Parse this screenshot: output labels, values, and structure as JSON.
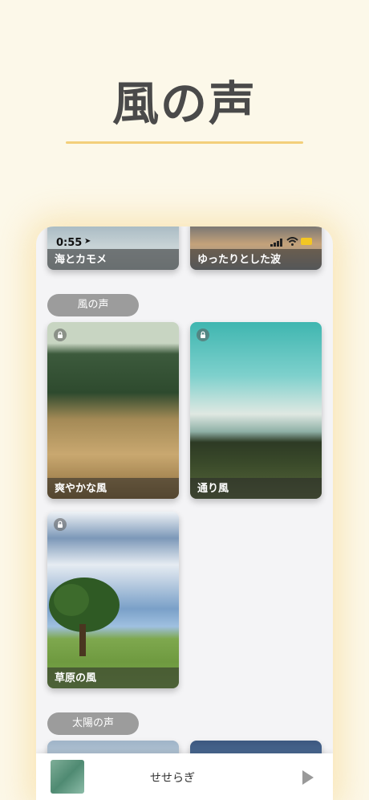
{
  "page_title": "風の声",
  "status_bar": {
    "time": "0:55",
    "location_glyph": "➤"
  },
  "top_cards": [
    {
      "label": "海とカモメ"
    },
    {
      "label": "ゆったりとした波"
    }
  ],
  "section_wind": {
    "pill": "風の声",
    "cards": [
      {
        "label": "爽やかな風",
        "locked": true
      },
      {
        "label": "通り風",
        "locked": true
      },
      {
        "label": "草原の風",
        "locked": true
      }
    ]
  },
  "section_sun": {
    "pill": "太陽の声"
  },
  "player": {
    "track_name": "せせらぎ"
  },
  "colors": {
    "background": "#fcf8e9",
    "accent": "#f3cf7a",
    "pill": "#9c9c9c"
  }
}
